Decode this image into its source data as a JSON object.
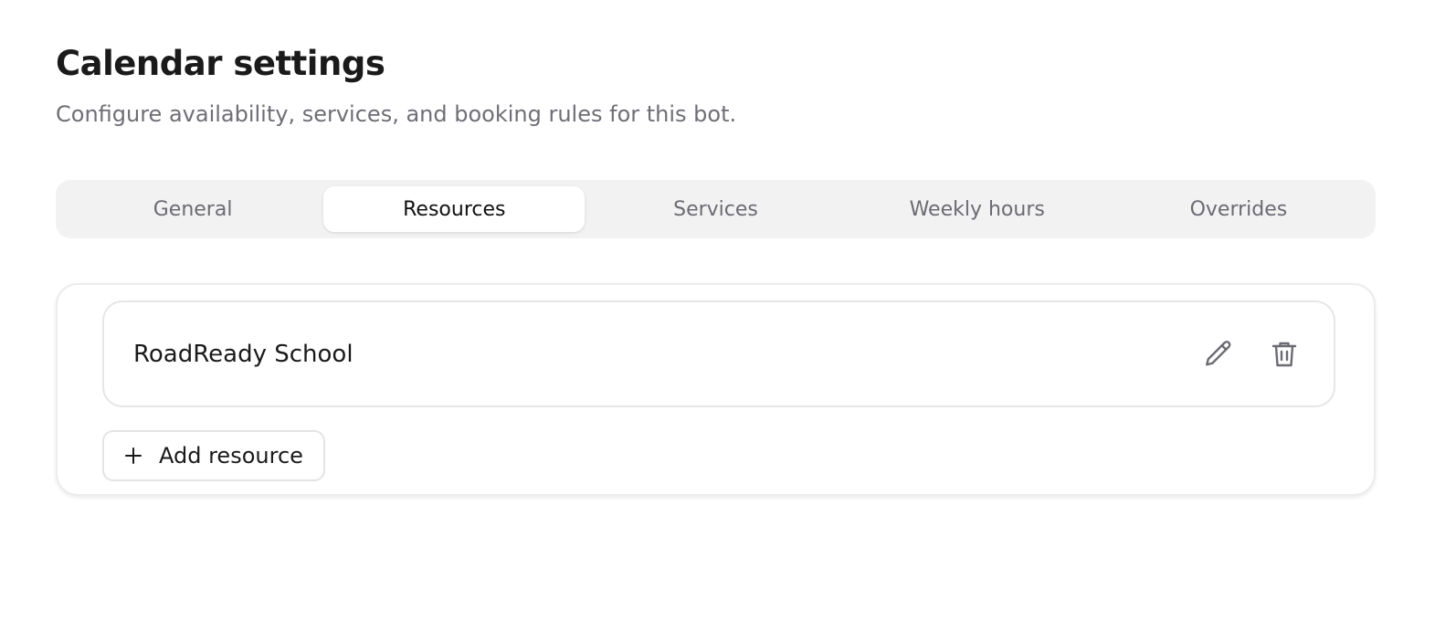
{
  "header": {
    "title": "Calendar settings",
    "subtitle": "Configure availability, services, and booking rules for this bot."
  },
  "tabs": [
    {
      "label": "General",
      "active": false
    },
    {
      "label": "Resources",
      "active": true
    },
    {
      "label": "Services",
      "active": false
    },
    {
      "label": "Weekly hours",
      "active": false
    },
    {
      "label": "Overrides",
      "active": false
    }
  ],
  "resources": {
    "items": [
      {
        "name": "RoadReady School",
        "edit_icon": "pencil-icon",
        "delete_icon": "trash-icon"
      }
    ],
    "add_label": "Add resource",
    "add_icon": "plus-icon"
  },
  "colors": {
    "tab_bar_bg": "#f2f2f3",
    "active_tab_bg": "#ffffff",
    "icon_color": "#6b6b72"
  }
}
